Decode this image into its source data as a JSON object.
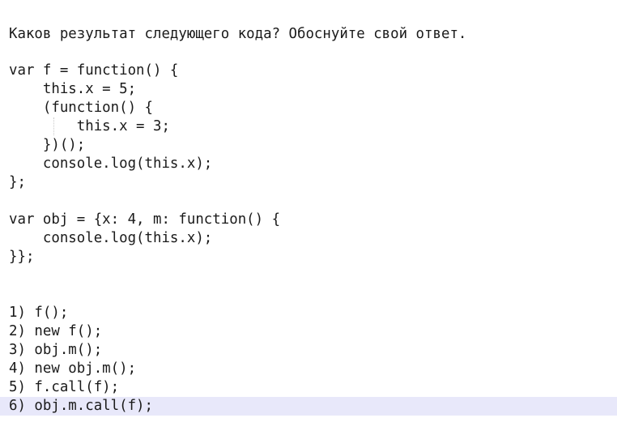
{
  "editor": {
    "lines": [
      "Каков результат следующего кода? Обоснуйте свой ответ.",
      "",
      "var f = function() {",
      "    this.x = 5;",
      "    (function() {",
      "        this.x = 3;",
      "    })();",
      "    console.log(this.x);",
      "};",
      "",
      "var obj = {x: 4, m: function() {",
      "    console.log(this.x);",
      "}};",
      "",
      "",
      "",
      "1) f();",
      "2) new f();",
      "3) obj.m();",
      "4) new obj.m();",
      "5) f.call(f);",
      "6) obj.m.call(f);"
    ],
    "highlight_color": "#e8e8fa"
  }
}
